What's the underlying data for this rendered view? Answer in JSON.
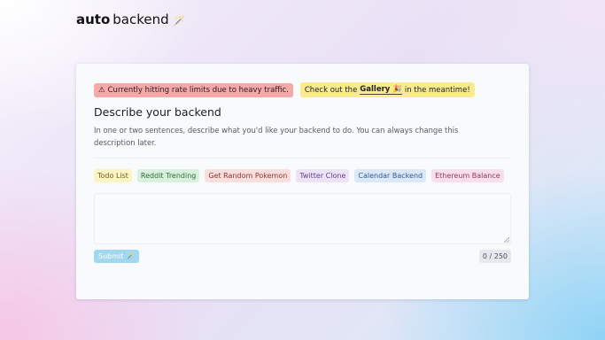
{
  "logo": {
    "bold": "auto",
    "light": "backend",
    "emoji": "🪄"
  },
  "banners": {
    "warning_icon": "⚠",
    "warning_text": "Currently hitting rate limits due to heavy traffic.",
    "gallery_prefix": "Check out the",
    "gallery_link": "Gallery",
    "gallery_emoji": "🎉",
    "gallery_suffix": "in the meantime!"
  },
  "form": {
    "title": "Describe your backend",
    "description": "In one or two sentences, describe what you'd like your backend to do. You can always change this description later.",
    "textarea_value": "",
    "submit_label": "Submit",
    "submit_emoji": "🪄",
    "counter": "0 / 250"
  },
  "examples": [
    {
      "label": "Todo List",
      "color": "#fdf4c4"
    },
    {
      "label": "Reddit Trending",
      "color": "#d8f1dc"
    },
    {
      "label": "Get Random Pokemon",
      "color": "#f9dede"
    },
    {
      "label": "Twitter Clone",
      "color": "#ece3f7"
    },
    {
      "label": "Calendar Backend",
      "color": "#dbe8f8"
    },
    {
      "label": "Ethereum Balance",
      "color": "#f9dfe9"
    }
  ]
}
